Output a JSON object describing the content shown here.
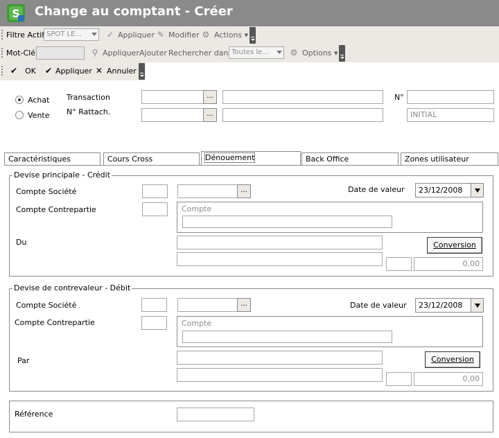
{
  "window": {
    "title": "Change au comptant - Créer"
  },
  "toolbar1": {
    "filter_label": "Filtre Actif",
    "filter_value": "SPOT LE...",
    "apply_label": "Appliquer",
    "modify_label": "Modifier",
    "actions_label": "Actions"
  },
  "toolbar2": {
    "keyword_label": "Mot-Clé",
    "apply_label": "Appliquer",
    "add_label": "Ajouter",
    "search_in_label": "Rechercher dans",
    "search_in_value": "Toutes le...",
    "options_label": "Options"
  },
  "toolbar3": {
    "ok_label": "OK",
    "apply_label": "Appliquer",
    "cancel_label": "Annuler"
  },
  "header": {
    "radio_achat": "Achat",
    "radio_vente": "Vente",
    "selected": "Achat",
    "transaction_label": "Transaction",
    "rattach_label": "N° Rattach.",
    "no_label": "N°",
    "status_value": "INITIAL"
  },
  "tabs": [
    {
      "label": "Caractéristiques",
      "active": false
    },
    {
      "label": "Cours Cross",
      "active": false
    },
    {
      "label": "Dénouement",
      "active": true
    },
    {
      "label": "Back Office",
      "active": false
    },
    {
      "label": "Zones utilisateur",
      "active": false
    }
  ],
  "credit": {
    "title": "Devise principale - Crédit",
    "compte_societe_label": "Compte Société",
    "compte_contrepartie_label": "Compte Contrepartie",
    "compte_label": "Compte",
    "du_label": "Du",
    "date_valeur_label": "Date de valeur",
    "date_valeur": "23/12/2008",
    "conversion_label": "Conversion",
    "amount": "0,00"
  },
  "debit": {
    "title": "Devise de contrevaleur - Débit",
    "compte_societe_label": "Compte Société",
    "compte_contrepartie_label": "Compte Contrepartie",
    "compte_label": "Compte",
    "par_label": "Par",
    "date_valeur_label": "Date de valeur",
    "date_valeur": "23/12/2008",
    "conversion_label": "Conversion",
    "amount": "0,00"
  },
  "reference": {
    "label": "Référence"
  },
  "ellipsis": "...",
  "colors": {
    "titlebar": "#8a8a8a",
    "toolbar": "#ece9e4",
    "icon_green": "#3f9a36"
  }
}
